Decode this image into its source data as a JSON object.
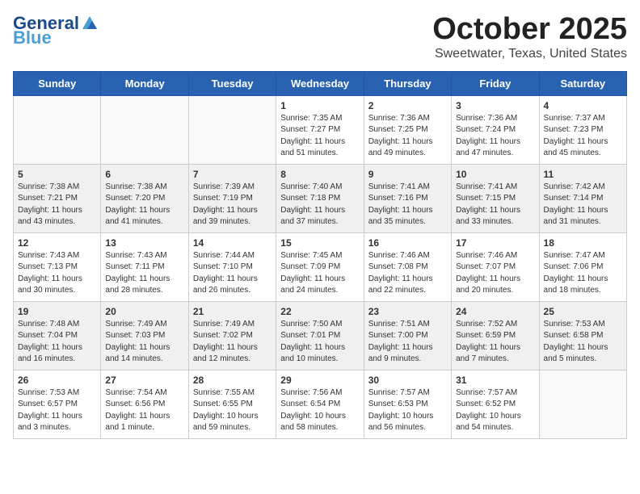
{
  "header": {
    "logo_line1": "General",
    "logo_line2": "Blue",
    "month": "October 2025",
    "location": "Sweetwater, Texas, United States"
  },
  "weekdays": [
    "Sunday",
    "Monday",
    "Tuesday",
    "Wednesday",
    "Thursday",
    "Friday",
    "Saturday"
  ],
  "weeks": [
    [
      {
        "day": "",
        "sunrise": "",
        "sunset": "",
        "daylight": ""
      },
      {
        "day": "",
        "sunrise": "",
        "sunset": "",
        "daylight": ""
      },
      {
        "day": "",
        "sunrise": "",
        "sunset": "",
        "daylight": ""
      },
      {
        "day": "1",
        "sunrise": "Sunrise: 7:35 AM",
        "sunset": "Sunset: 7:27 PM",
        "daylight": "Daylight: 11 hours and 51 minutes."
      },
      {
        "day": "2",
        "sunrise": "Sunrise: 7:36 AM",
        "sunset": "Sunset: 7:25 PM",
        "daylight": "Daylight: 11 hours and 49 minutes."
      },
      {
        "day": "3",
        "sunrise": "Sunrise: 7:36 AM",
        "sunset": "Sunset: 7:24 PM",
        "daylight": "Daylight: 11 hours and 47 minutes."
      },
      {
        "day": "4",
        "sunrise": "Sunrise: 7:37 AM",
        "sunset": "Sunset: 7:23 PM",
        "daylight": "Daylight: 11 hours and 45 minutes."
      }
    ],
    [
      {
        "day": "5",
        "sunrise": "Sunrise: 7:38 AM",
        "sunset": "Sunset: 7:21 PM",
        "daylight": "Daylight: 11 hours and 43 minutes."
      },
      {
        "day": "6",
        "sunrise": "Sunrise: 7:38 AM",
        "sunset": "Sunset: 7:20 PM",
        "daylight": "Daylight: 11 hours and 41 minutes."
      },
      {
        "day": "7",
        "sunrise": "Sunrise: 7:39 AM",
        "sunset": "Sunset: 7:19 PM",
        "daylight": "Daylight: 11 hours and 39 minutes."
      },
      {
        "day": "8",
        "sunrise": "Sunrise: 7:40 AM",
        "sunset": "Sunset: 7:18 PM",
        "daylight": "Daylight: 11 hours and 37 minutes."
      },
      {
        "day": "9",
        "sunrise": "Sunrise: 7:41 AM",
        "sunset": "Sunset: 7:16 PM",
        "daylight": "Daylight: 11 hours and 35 minutes."
      },
      {
        "day": "10",
        "sunrise": "Sunrise: 7:41 AM",
        "sunset": "Sunset: 7:15 PM",
        "daylight": "Daylight: 11 hours and 33 minutes."
      },
      {
        "day": "11",
        "sunrise": "Sunrise: 7:42 AM",
        "sunset": "Sunset: 7:14 PM",
        "daylight": "Daylight: 11 hours and 31 minutes."
      }
    ],
    [
      {
        "day": "12",
        "sunrise": "Sunrise: 7:43 AM",
        "sunset": "Sunset: 7:13 PM",
        "daylight": "Daylight: 11 hours and 30 minutes."
      },
      {
        "day": "13",
        "sunrise": "Sunrise: 7:43 AM",
        "sunset": "Sunset: 7:11 PM",
        "daylight": "Daylight: 11 hours and 28 minutes."
      },
      {
        "day": "14",
        "sunrise": "Sunrise: 7:44 AM",
        "sunset": "Sunset: 7:10 PM",
        "daylight": "Daylight: 11 hours and 26 minutes."
      },
      {
        "day": "15",
        "sunrise": "Sunrise: 7:45 AM",
        "sunset": "Sunset: 7:09 PM",
        "daylight": "Daylight: 11 hours and 24 minutes."
      },
      {
        "day": "16",
        "sunrise": "Sunrise: 7:46 AM",
        "sunset": "Sunset: 7:08 PM",
        "daylight": "Daylight: 11 hours and 22 minutes."
      },
      {
        "day": "17",
        "sunrise": "Sunrise: 7:46 AM",
        "sunset": "Sunset: 7:07 PM",
        "daylight": "Daylight: 11 hours and 20 minutes."
      },
      {
        "day": "18",
        "sunrise": "Sunrise: 7:47 AM",
        "sunset": "Sunset: 7:06 PM",
        "daylight": "Daylight: 11 hours and 18 minutes."
      }
    ],
    [
      {
        "day": "19",
        "sunrise": "Sunrise: 7:48 AM",
        "sunset": "Sunset: 7:04 PM",
        "daylight": "Daylight: 11 hours and 16 minutes."
      },
      {
        "day": "20",
        "sunrise": "Sunrise: 7:49 AM",
        "sunset": "Sunset: 7:03 PM",
        "daylight": "Daylight: 11 hours and 14 minutes."
      },
      {
        "day": "21",
        "sunrise": "Sunrise: 7:49 AM",
        "sunset": "Sunset: 7:02 PM",
        "daylight": "Daylight: 11 hours and 12 minutes."
      },
      {
        "day": "22",
        "sunrise": "Sunrise: 7:50 AM",
        "sunset": "Sunset: 7:01 PM",
        "daylight": "Daylight: 11 hours and 10 minutes."
      },
      {
        "day": "23",
        "sunrise": "Sunrise: 7:51 AM",
        "sunset": "Sunset: 7:00 PM",
        "daylight": "Daylight: 11 hours and 9 minutes."
      },
      {
        "day": "24",
        "sunrise": "Sunrise: 7:52 AM",
        "sunset": "Sunset: 6:59 PM",
        "daylight": "Daylight: 11 hours and 7 minutes."
      },
      {
        "day": "25",
        "sunrise": "Sunrise: 7:53 AM",
        "sunset": "Sunset: 6:58 PM",
        "daylight": "Daylight: 11 hours and 5 minutes."
      }
    ],
    [
      {
        "day": "26",
        "sunrise": "Sunrise: 7:53 AM",
        "sunset": "Sunset: 6:57 PM",
        "daylight": "Daylight: 11 hours and 3 minutes."
      },
      {
        "day": "27",
        "sunrise": "Sunrise: 7:54 AM",
        "sunset": "Sunset: 6:56 PM",
        "daylight": "Daylight: 11 hours and 1 minute."
      },
      {
        "day": "28",
        "sunrise": "Sunrise: 7:55 AM",
        "sunset": "Sunset: 6:55 PM",
        "daylight": "Daylight: 10 hours and 59 minutes."
      },
      {
        "day": "29",
        "sunrise": "Sunrise: 7:56 AM",
        "sunset": "Sunset: 6:54 PM",
        "daylight": "Daylight: 10 hours and 58 minutes."
      },
      {
        "day": "30",
        "sunrise": "Sunrise: 7:57 AM",
        "sunset": "Sunset: 6:53 PM",
        "daylight": "Daylight: 10 hours and 56 minutes."
      },
      {
        "day": "31",
        "sunrise": "Sunrise: 7:57 AM",
        "sunset": "Sunset: 6:52 PM",
        "daylight": "Daylight: 10 hours and 54 minutes."
      },
      {
        "day": "",
        "sunrise": "",
        "sunset": "",
        "daylight": ""
      }
    ]
  ]
}
